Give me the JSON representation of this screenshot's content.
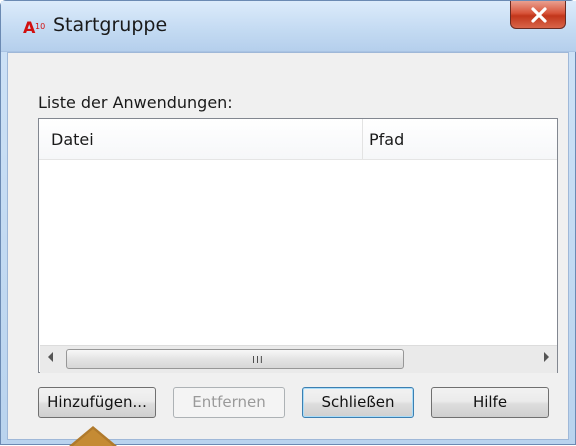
{
  "window": {
    "title": "Startgruppe",
    "app_icon": "autocad-a10-icon",
    "close_icon": "close-icon"
  },
  "list": {
    "label": "Liste der Anwendungen:",
    "columns": [
      "Datei",
      "Pfad"
    ],
    "rows": []
  },
  "scrollbar": {
    "left_icon": "chevron-left-icon",
    "right_icon": "chevron-right-icon",
    "thumb_grip": "III"
  },
  "buttons": {
    "add": "Hinzufügen...",
    "remove": "Entfernen",
    "close": "Schließen",
    "help": "Hilfe"
  },
  "annotation": {
    "arrow_icon": "up-triangle-pointer-icon",
    "arrow_color": "#b07a2c"
  }
}
